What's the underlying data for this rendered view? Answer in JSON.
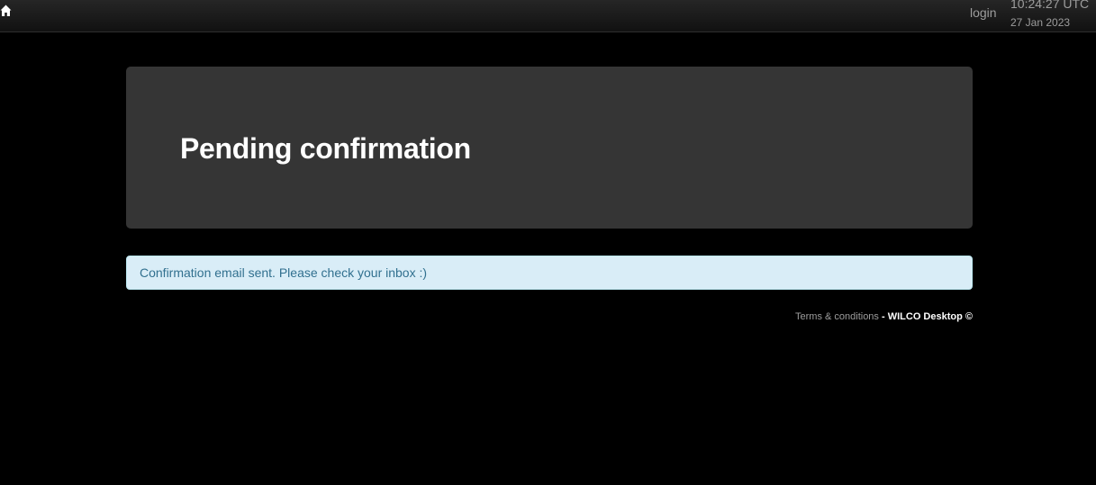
{
  "topbar": {
    "home_icon": "home-icon",
    "login_label": "login",
    "clock_time": "10:24:27 UTC",
    "clock_date": "27 Jan 2023"
  },
  "main": {
    "title": "Pending confirmation",
    "alert_message": "Confirmation email sent. Please check your inbox :)"
  },
  "footer": {
    "terms_label": "Terms & conditions",
    "separator": " - ",
    "brand": "WILCO Desktop ©"
  },
  "colors": {
    "background": "#000000",
    "jumbotron": "#353535",
    "alert_bg": "#d9edf7",
    "alert_text": "#31708f",
    "muted_text": "#9d9d9d"
  }
}
